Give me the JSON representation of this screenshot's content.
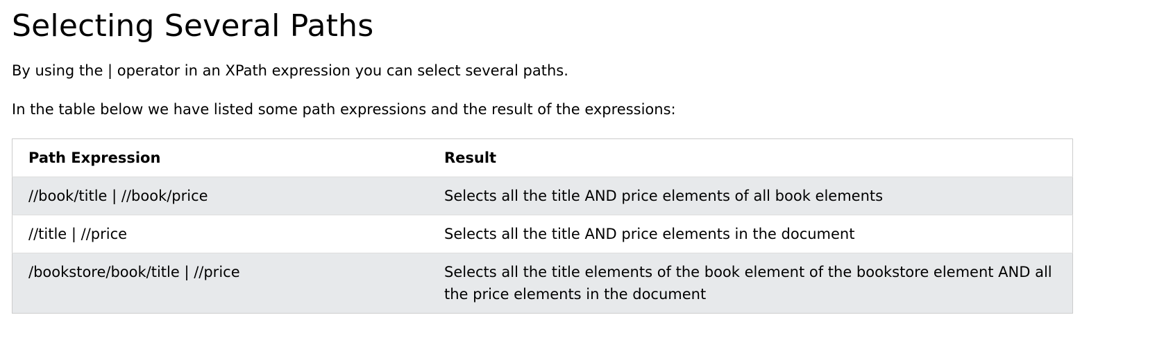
{
  "heading": "Selecting Several Paths",
  "paragraphs": [
    "By using the | operator in an XPath expression you can select several paths.",
    "In the table below we have listed some path expressions and the result of the expressions:"
  ],
  "table": {
    "headers": [
      "Path Expression",
      "Result"
    ],
    "rows": [
      [
        "//book/title | //book/price",
        "Selects all the title AND price elements of all book elements"
      ],
      [
        "//title | //price",
        "Selects all the title AND price elements in the document"
      ],
      [
        "/bookstore/book/title | //price",
        "Selects all the title elements of the book element of the bookstore element AND all the price elements in the document"
      ]
    ]
  }
}
